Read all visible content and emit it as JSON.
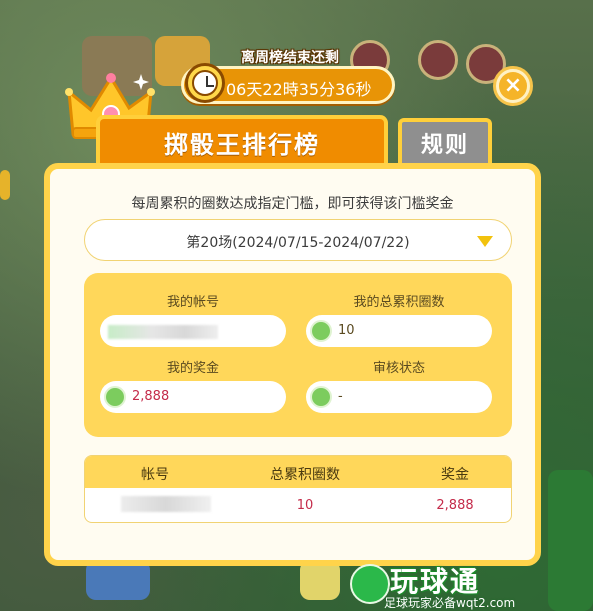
{
  "timer": {
    "title": "离周榜结束还剩",
    "countdown": "06天22時35分36秒"
  },
  "tabs": {
    "active_label": "掷骰王排行榜",
    "rules_label": "规则"
  },
  "panel": {
    "subtitle": "每周累积的圈数达成指定门槛，即可获得该门槛奖金",
    "season": "第20场(2024/07/15-2024/07/22)"
  },
  "stats": {
    "account_label": "我的帐号",
    "total_laps_label": "我的总累积圈数",
    "total_laps_value": "10",
    "prize_label": "我的奖金",
    "prize_value": "2,888",
    "review_label": "审核状态",
    "review_value": "-"
  },
  "table": {
    "headers": [
      "帐号",
      "总累积圈数",
      "奖金"
    ],
    "rows": [
      {
        "laps": "10",
        "prize": "2,888"
      }
    ]
  },
  "watermark": {
    "brand": "玩球通",
    "url": "足球玩家必备wqt2.com"
  },
  "icons": {
    "clock": "clock-icon",
    "close": "close-icon",
    "dropdown": "chevron-down-icon",
    "laps": "pencil-icon",
    "prize": "dollar-coin-icon",
    "review": "bell-icon"
  },
  "colors": {
    "accent_orange": "#f08c00",
    "panel_border": "#ffd34a",
    "value_red": "#c42b4a",
    "tab_inactive": "#8f8f8f"
  }
}
